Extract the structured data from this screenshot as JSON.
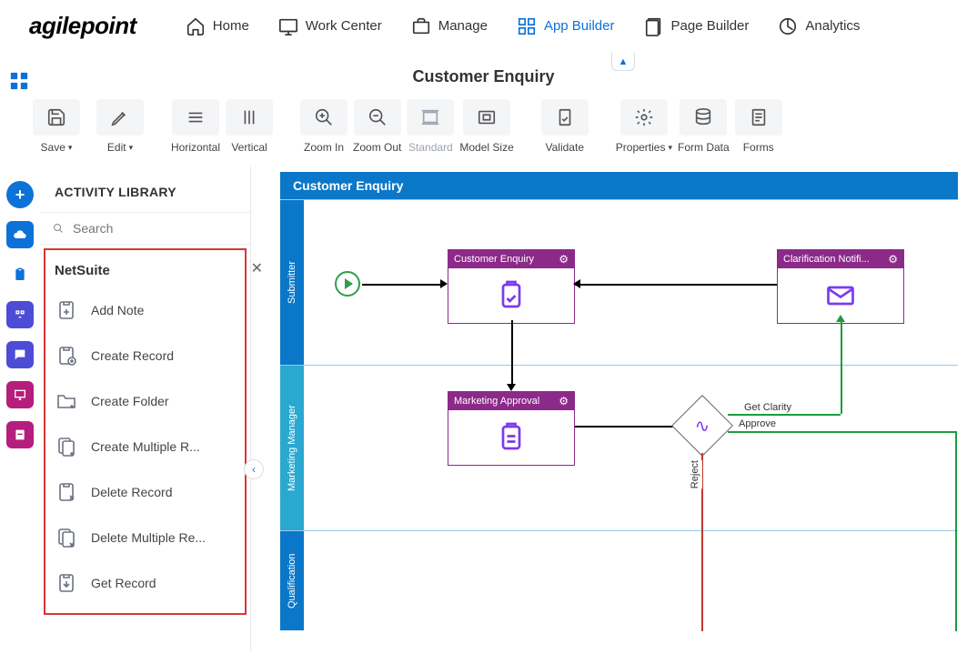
{
  "logo": "agilepoint",
  "nav": {
    "home": "Home",
    "work_center": "Work Center",
    "manage": "Manage",
    "app_builder": "App Builder",
    "page_builder": "Page Builder",
    "analytics": "Analytics"
  },
  "process_title": "Customer Enquiry",
  "toolbar": {
    "save": "Save",
    "edit": "Edit",
    "horizontal": "Horizontal",
    "vertical": "Vertical",
    "zoom_in": "Zoom In",
    "zoom_out": "Zoom Out",
    "standard": "Standard",
    "model_size": "Model Size",
    "validate": "Validate",
    "properties": "Properties",
    "form_data": "Form Data",
    "forms": "Forms"
  },
  "library": {
    "title": "ACTIVITY LIBRARY",
    "search_placeholder": "Search",
    "group": "NetSuite",
    "items": {
      "add_note": "Add Note",
      "create_record": "Create Record",
      "create_folder": "Create Folder",
      "create_multiple": "Create Multiple R...",
      "delete_record": "Delete Record",
      "delete_multiple": "Delete Multiple Re...",
      "get_record": "Get Record"
    }
  },
  "canvas": {
    "title": "Customer Enquiry",
    "lanes": {
      "submitter": "Submitter",
      "marketing_manager": "Marketing Manager",
      "qualification": "Qualification"
    },
    "activities": {
      "customer_enquiry": "Customer Enquiry",
      "clarification": "Clarification Notifi...",
      "marketing_approval": "Marketing Approval"
    },
    "edges": {
      "get_clarity": "Get Clarity",
      "approve": "Approve",
      "reject": "Reject"
    }
  }
}
